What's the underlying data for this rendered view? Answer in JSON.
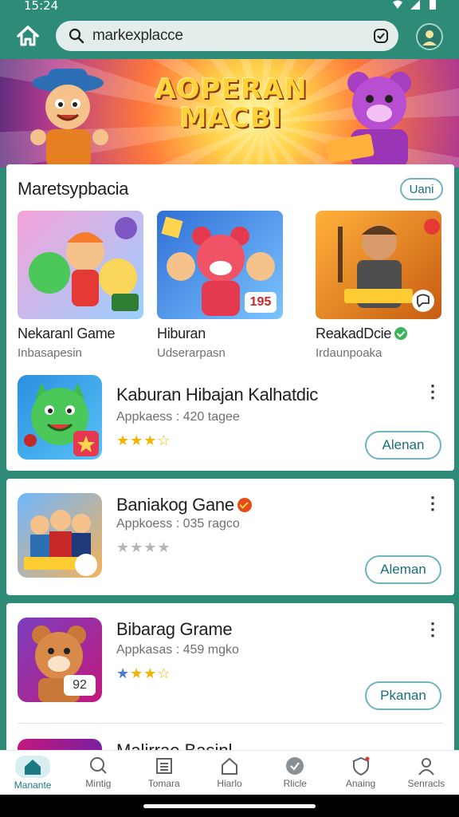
{
  "status_bar": {
    "time": "15:24"
  },
  "search": {
    "query": "markexplacce"
  },
  "banner": {
    "title": "AOPERAN MACBI"
  },
  "section": {
    "title": "Maretsypbacia",
    "more_label": "Uani",
    "tiles": [
      {
        "name": "Nekaranl Game",
        "subtitle": "Inbasapesin",
        "badge": ""
      },
      {
        "name": "Hiburan",
        "subtitle": "Udserarpasn",
        "badge": "195"
      },
      {
        "name": "ReakadDcie",
        "subtitle": "Irdaunpoaka",
        "badge": ""
      }
    ]
  },
  "list": [
    {
      "title": "Kaburan Hibajan Kalhatdic",
      "meta": "Appkaess : 420 tagee",
      "rating": 3.5,
      "button": "Alenan",
      "badge": ""
    },
    {
      "title": "Baniakog Gane",
      "meta": "Appkoess : 035 ragco",
      "rating": 0,
      "button": "Aleman",
      "badge": ""
    },
    {
      "title": "Bibarag Grame",
      "meta": "Appkasas : 459 mgko",
      "rating": 3.5,
      "button": "Pkanan",
      "badge": "92"
    }
  ],
  "peek": {
    "title": "Malirrae Basinl"
  },
  "bottom_nav": [
    {
      "label": "Manante",
      "icon": "home-icon",
      "active": true
    },
    {
      "label": "Mintig",
      "icon": "search-icon",
      "active": false
    },
    {
      "label": "Tomara",
      "icon": "list-icon",
      "active": false
    },
    {
      "label": "Hiarlo",
      "icon": "house-icon",
      "active": false
    },
    {
      "label": "Rlicle",
      "icon": "check-circle-icon",
      "active": false
    },
    {
      "label": "Anaing",
      "icon": "shield-icon",
      "active": false
    },
    {
      "label": "Senracls",
      "icon": "person-icon",
      "active": false
    }
  ],
  "colors": {
    "brand": "#2e8b78",
    "accent": "#1d7a85",
    "star": "#f2b400"
  }
}
